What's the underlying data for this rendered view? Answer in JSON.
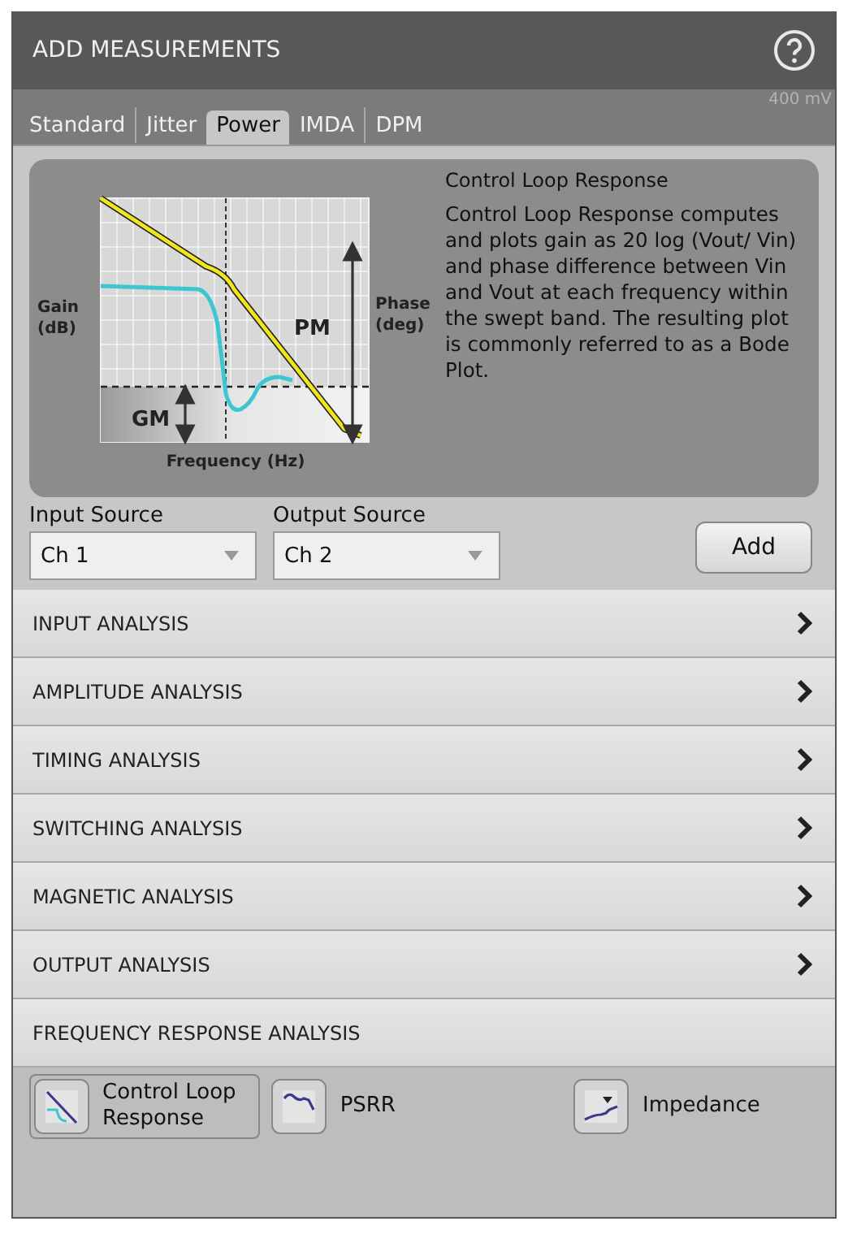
{
  "window": {
    "title": "ADD MEASUREMENTS",
    "background_label": "400 mV"
  },
  "tabs": [
    {
      "label": "Standard",
      "selected": false
    },
    {
      "label": "Jitter",
      "selected": false
    },
    {
      "label": "Power",
      "selected": true
    },
    {
      "label": "IMDA",
      "selected": false
    },
    {
      "label": "DPM",
      "selected": false
    }
  ],
  "diagram": {
    "gain_label": "Gain\n(dB)",
    "phase_label": "Phase\n(deg)",
    "pm_label": "PM",
    "gm_label": "GM",
    "x_label": "Frequency (Hz)"
  },
  "description": {
    "title": "Control Loop Response",
    "text": "Control Loop Response computes and plots gain as 20 log (Vout/ Vin) and phase difference between Vin and Vout at each frequency within the swept band. The resulting plot is commonly referred to as a Bode Plot."
  },
  "input_source": {
    "label": "Input Source",
    "value": "Ch 1"
  },
  "output_source": {
    "label": "Output Source",
    "value": "Ch 2"
  },
  "add_button": "Add",
  "sections": [
    {
      "label": "INPUT ANALYSIS",
      "expanded": false
    },
    {
      "label": "AMPLITUDE ANALYSIS",
      "expanded": false
    },
    {
      "label": "TIMING ANALYSIS",
      "expanded": false
    },
    {
      "label": "SWITCHING ANALYSIS",
      "expanded": false
    },
    {
      "label": "MAGNETIC ANALYSIS",
      "expanded": false
    },
    {
      "label": "OUTPUT ANALYSIS",
      "expanded": false
    },
    {
      "label": "FREQUENCY RESPONSE ANALYSIS",
      "expanded": true
    }
  ],
  "measurements": [
    {
      "kind": "control-loop",
      "label": "Control Loop\nResponse",
      "selected": true
    },
    {
      "kind": "psrr",
      "label": "PSRR",
      "selected": false
    },
    {
      "kind": "impedance",
      "label": "Impedance",
      "selected": false
    }
  ]
}
